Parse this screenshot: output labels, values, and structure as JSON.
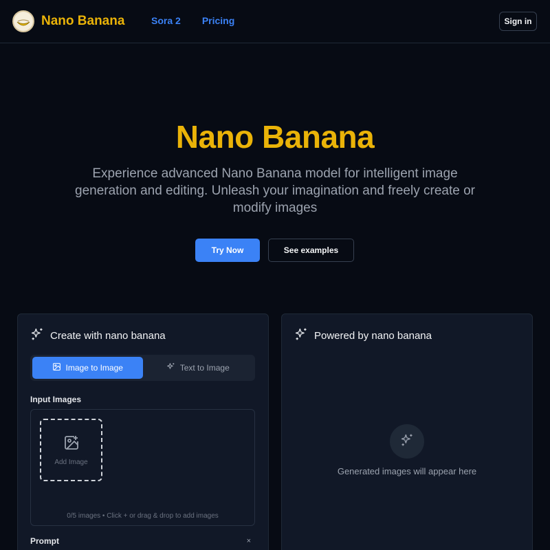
{
  "header": {
    "logo_text": "Nano Banana",
    "nav": [
      {
        "label": "Sora 2"
      },
      {
        "label": "Pricing"
      }
    ],
    "signin_label": "Sign in"
  },
  "hero": {
    "title": "Nano Banana",
    "description": "Experience advanced Nano Banana model for intelligent image generation and editing. Unleash your imagination and freely create or modify images",
    "primary_button": "Try Now",
    "secondary_button": "See examples"
  },
  "create_panel": {
    "title": "Create with nano banana",
    "tabs": [
      {
        "label": "Image to Image",
        "active": true,
        "icon": "image-icon"
      },
      {
        "label": "Text to Image",
        "active": false,
        "icon": "sparkles-icon"
      }
    ],
    "input_images_label": "Input Images",
    "add_image_label": "Add Image",
    "upload_hint": "0/5 images • Click + or drag & drop to add images",
    "prompt_label": "Prompt",
    "clear_symbol": "×"
  },
  "output_panel": {
    "title": "Powered by nano banana",
    "placeholder": "Generated images will appear here"
  },
  "colors": {
    "background": "#070b14",
    "brand_yellow": "#eab308",
    "accent_blue": "#3b82f6",
    "panel": "#111827"
  }
}
